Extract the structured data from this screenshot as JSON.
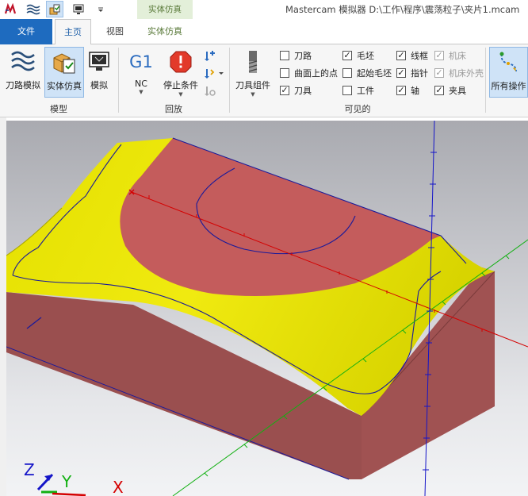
{
  "window": {
    "title": "Mastercam 模拟器  D:\\工作\\程序\\震荡粒子\\夹片1.mcam",
    "context_group": "实体仿真"
  },
  "tabs": {
    "file": "文件",
    "home": "主页",
    "view": "视图",
    "context": "实体仿真"
  },
  "ribbon": {
    "model_group": {
      "label": "模型",
      "backplot": "刀路模拟",
      "verify": "实体仿真",
      "simulate": "模拟"
    },
    "playback_group": {
      "label": "回放",
      "nc_icon": "G1",
      "nc": "NC",
      "stop": "停止条件"
    },
    "visible_group": {
      "label": "可见的",
      "tool_assembly": "刀具组件",
      "checkboxes": [
        {
          "label": "刀路",
          "checked": false,
          "disabled": false
        },
        {
          "label": "曲面上的点",
          "checked": false,
          "disabled": false
        },
        {
          "label": "刀具",
          "checked": true,
          "disabled": false
        },
        {
          "label": "毛坯",
          "checked": true,
          "disabled": false
        },
        {
          "label": "起始毛坯",
          "checked": false,
          "disabled": false
        },
        {
          "label": "工件",
          "checked": false,
          "disabled": false
        },
        {
          "label": "线框",
          "checked": true,
          "disabled": false
        },
        {
          "label": "指针",
          "checked": true,
          "disabled": false
        },
        {
          "label": "轴",
          "checked": true,
          "disabled": false
        },
        {
          "label": "机床",
          "checked": true,
          "disabled": true
        },
        {
          "label": "机床外壳",
          "checked": true,
          "disabled": true
        },
        {
          "label": "夹具",
          "checked": true,
          "disabled": false
        }
      ],
      "all_ops": "所有操作"
    }
  },
  "axes": {
    "x": "X",
    "y": "Y",
    "z": "Z"
  },
  "colors": {
    "stock_red": "#c45c5c",
    "stock_side": "#9a4f4f",
    "surface_yellow": "#e4e000",
    "toolpath_blue": "#1a1a9a",
    "axis_x": "#d40000",
    "axis_y": "#12b012",
    "axis_z": "#1414c8",
    "accent": "#1e6bbf"
  }
}
